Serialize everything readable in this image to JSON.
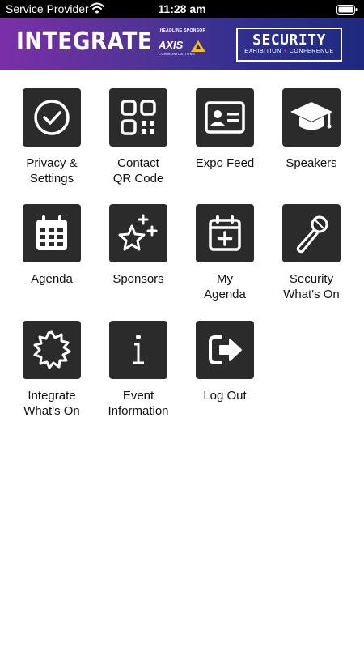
{
  "status_bar": {
    "carrier": "Service Provider",
    "time": "11:28 am"
  },
  "banner": {
    "integrate": "INTEGRATE",
    "sponsor_label": "HEADLINE SPONSOR",
    "axis_name": "AXIS",
    "axis_sub": "COMMUNICATIONS",
    "security_title": "SECURITY",
    "security_sub_a": "EXHIBITION",
    "security_sub_plus": "+",
    "security_sub_b": "CONFERENCE"
  },
  "menu": [
    {
      "label": "Privacy &\nSettings",
      "icon": "check-circle-icon"
    },
    {
      "label": "Contact\nQR Code",
      "icon": "qr-code-icon"
    },
    {
      "label": "Expo Feed",
      "icon": "id-card-icon"
    },
    {
      "label": "Speakers",
      "icon": "graduation-cap-icon"
    },
    {
      "label": "Agenda",
      "icon": "calendar-grid-icon"
    },
    {
      "label": "Sponsors",
      "icon": "star-sparkle-icon"
    },
    {
      "label": "My\nAgenda",
      "icon": "calendar-plus-icon"
    },
    {
      "label": "Security\nWhat's On",
      "icon": "microphone-icon"
    },
    {
      "label": "Integrate\nWhat's On",
      "icon": "starburst-icon"
    },
    {
      "label": "Event\nInformation",
      "icon": "info-icon"
    },
    {
      "label": "Log Out",
      "icon": "logout-icon"
    }
  ],
  "colors": {
    "tile": "#2b2b2b",
    "banner_start": "#7b2fa8",
    "banner_end": "#1e2a7e",
    "accent_plus": "#e8364a"
  }
}
